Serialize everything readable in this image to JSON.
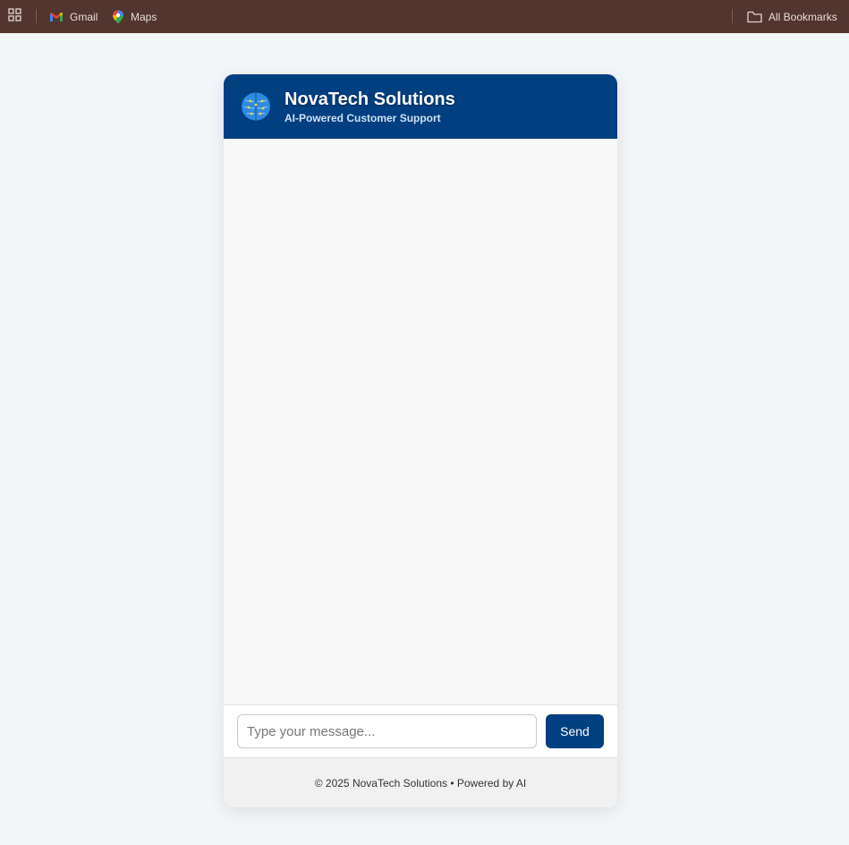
{
  "bookmarks": {
    "items": [
      {
        "label": "Gmail",
        "icon": "gmail-icon"
      },
      {
        "label": "Maps",
        "icon": "maps-icon"
      }
    ],
    "all_bookmarks_label": "All Bookmarks"
  },
  "chat": {
    "title": "NovaTech Solutions",
    "subtitle": "AI-Powered Customer Support",
    "input_placeholder": "Type your message...",
    "input_value": "",
    "send_label": "Send",
    "footer": "© 2025 NovaTech Solutions • Powered by AI"
  },
  "colors": {
    "bookmarks_bar": "#533530",
    "header": "#003f80",
    "send_button": "#003f80",
    "page_background": "#f3f6f9"
  }
}
